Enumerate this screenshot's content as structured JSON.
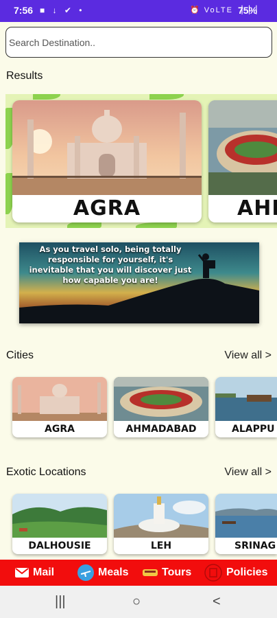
{
  "status_bar": {
    "time": "7:56",
    "left_icons": "■ ↓ ✔ •",
    "right_icons": "⏰ VoLTE ▕▕▕",
    "battery": "75%"
  },
  "search": {
    "placeholder": "Search Destination.."
  },
  "results": {
    "title": "Results",
    "cards": [
      {
        "label": "AGRA"
      },
      {
        "label": "AHI"
      }
    ]
  },
  "quote": {
    "text": "As you travel solo, being totally responsible for yourself, it's inevitable that you will discover just how capable you are!"
  },
  "cities": {
    "title": "Cities",
    "view_all": "View all >",
    "cards": [
      {
        "label": "AGRA"
      },
      {
        "label": "AHMADABAD"
      },
      {
        "label": "ALAPPU"
      }
    ]
  },
  "exotic": {
    "title": "Exotic Locations",
    "view_all": "View all >",
    "cards": [
      {
        "label": "DALHOUSIE"
      },
      {
        "label": "LEH"
      },
      {
        "label": "SRINAG"
      }
    ]
  },
  "bottom_nav": {
    "items": [
      {
        "label": "Mail",
        "icon": "mail-icon"
      },
      {
        "label": "Meals",
        "icon": "airplane-icon"
      },
      {
        "label": "Tours",
        "icon": "tours-icon"
      },
      {
        "label": "Policies",
        "icon": "policies-icon"
      }
    ]
  },
  "system_nav": {
    "recents": "|||",
    "home": "○",
    "back": "<"
  },
  "colors": {
    "status_bar": "#5b2be0",
    "background": "#fbfbe9",
    "bottom_nav": "#f20d0d",
    "results_band": "#e4f3b6"
  }
}
